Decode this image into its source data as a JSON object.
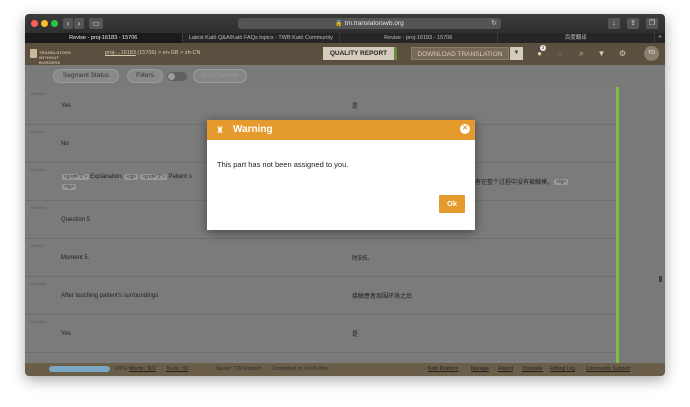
{
  "browser": {
    "url": "tm.translatorswb.org",
    "tabs": [
      {
        "label": "Revise - proj-16183 - 15706",
        "active": true
      },
      {
        "label": "Latest Katō Q&A/Katō FAQs topics - TWB Katō Community",
        "active": false
      },
      {
        "label": "Revise - proj-16183 - 15706",
        "active": false
      },
      {
        "label": "百度翻译",
        "active": false
      }
    ]
  },
  "header": {
    "logo_line1": "TRANSLATORS",
    "logo_line2": "WITHOUT BORDERS",
    "project_link": "proj-...16183",
    "project_id": "(15706)",
    "lang_pair": "> en-GB > zh-CN",
    "quality_report": "QUALITY REPORT",
    "download_translation": "DOWNLOAD TRANSLATION",
    "notification_count": "3",
    "avatar_initials": "YD"
  },
  "filters": {
    "segment_status": "Segment Status",
    "filters": "Filters",
    "data_sample": "Data Sample"
  },
  "segments": [
    {
      "id": "2518815",
      "source": "Yes",
      "target": "是"
    },
    {
      "id": "2518814",
      "source": "No",
      "target": ""
    },
    {
      "id": "2518813",
      "source_prefix": "Explanation:",
      "source_mid": "Patient s",
      "target": "患者在整个过程中没有被触摸。"
    },
    {
      "id": "2518816",
      "source": "Question 5",
      "target": ""
    },
    {
      "id": "2518817",
      "source": "Moment 5.",
      "target": "时刻5。"
    },
    {
      "id": "2518818",
      "source": "After touching patient's surroundings",
      "target": "接触患者周围环境之后"
    },
    {
      "id": "2518819",
      "source": "Yes",
      "target": "是"
    }
  ],
  "tags": {
    "open1": "<g id=\"1\">",
    "close1": "</g>",
    "open2": "<g id=\"2\">",
    "close2": "</g>",
    "close3": "</g>"
  },
  "status": {
    "percent": "100%",
    "words": "Words : 901",
    "todo": "To-do : 93",
    "speed": "Speed: 729 Words/h",
    "completed": "Completed in: 0d 0h 00m",
    "links": [
      "Katō Platform",
      "Manage",
      "Report",
      "Translate",
      "Editing Log",
      "Community Support"
    ]
  },
  "modal": {
    "title": "Warning",
    "message": "This part has not been assigned to you.",
    "ok": "Ok"
  },
  "colors": {
    "accent": "#e59a2e",
    "header": "#5b5040",
    "confirmed": "#7fbf3f"
  }
}
